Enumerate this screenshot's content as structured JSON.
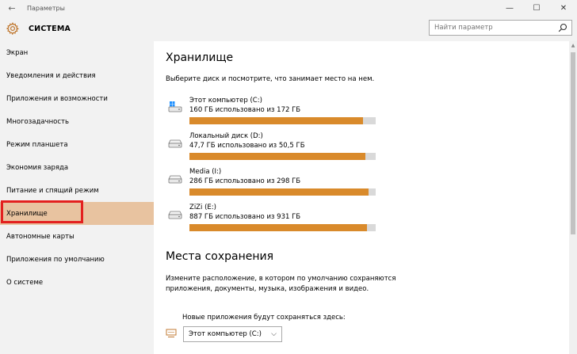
{
  "window": {
    "title": "Параметры",
    "back_glyph": "←",
    "minimize_glyph": "—",
    "maximize_glyph": "☐",
    "close_glyph": "✕"
  },
  "header": {
    "title": "СИСТЕМА",
    "search_placeholder": "Найти параметр"
  },
  "sidebar": {
    "items": [
      {
        "label": "Экран"
      },
      {
        "label": "Уведомления и действия"
      },
      {
        "label": "Приложения и возможности"
      },
      {
        "label": "Многозадачность"
      },
      {
        "label": "Режим планшета"
      },
      {
        "label": "Экономия заряда"
      },
      {
        "label": "Питание и спящий режим"
      },
      {
        "label": "Хранилище",
        "active": true
      },
      {
        "label": "Автономные карты"
      },
      {
        "label": "Приложения по умолчанию"
      },
      {
        "label": "О системе"
      }
    ]
  },
  "storage": {
    "heading": "Хранилище",
    "description": "Выберите диск и посмотрите, что занимает место на нем.",
    "drives": [
      {
        "name": "Этот компьютер (C:)",
        "usage": "160 ГБ использовано из 172 ГБ",
        "fraction": 0.93,
        "icon": "windows-drive-icon"
      },
      {
        "name": "Локальный диск (D:)",
        "usage": "47,7 ГБ использовано из 50,5 ГБ",
        "fraction": 0.945,
        "icon": "drive-icon"
      },
      {
        "name": "Media (I:)",
        "usage": "286 ГБ использовано из 298 ГБ",
        "fraction": 0.96,
        "icon": "drive-icon"
      },
      {
        "name": "ZiZi (E:)",
        "usage": "887 ГБ использовано из 931 ГБ",
        "fraction": 0.953,
        "icon": "drive-icon"
      }
    ]
  },
  "save_locations": {
    "heading": "Места сохранения",
    "description": "Измените расположение, в котором по умолчанию сохраняются приложения, документы, музыка, изображения и видео.",
    "new_apps_label": "Новые приложения будут сохраняться здесь:",
    "new_apps_value": "Этот компьютер (C:)"
  },
  "colors": {
    "accent": "#d98a2b",
    "active_nav": "#e8c3a0",
    "highlight_box": "#e3201f"
  }
}
